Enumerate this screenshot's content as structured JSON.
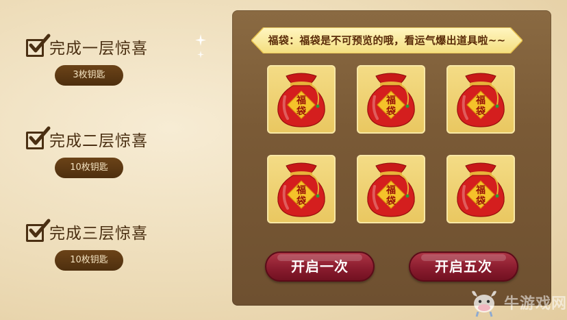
{
  "tasks": [
    {
      "title": "完成一层惊喜",
      "reward": "3枚钥匙"
    },
    {
      "title": "完成二层惊喜",
      "reward": "10枚钥匙"
    },
    {
      "title": "完成三层惊喜",
      "reward": "10枚钥匙"
    }
  ],
  "panel": {
    "tip": "福袋：福袋是不可预览的哦，看运气爆出道具啦~~",
    "bag_label_top": "福",
    "bag_label_bottom": "袋",
    "bag_count": 6,
    "open_once": "开启一次",
    "open_five": "开启五次"
  },
  "watermark": {
    "text": "牛游戏网",
    "icon": "cow-mascot-icon"
  },
  "colors": {
    "panel_brown": "#7a5a36",
    "badge_brown": "#5a3612",
    "button_red": "#8a1c2e",
    "slot_gold": "#efd070",
    "bag_red": "#d41e1e"
  }
}
